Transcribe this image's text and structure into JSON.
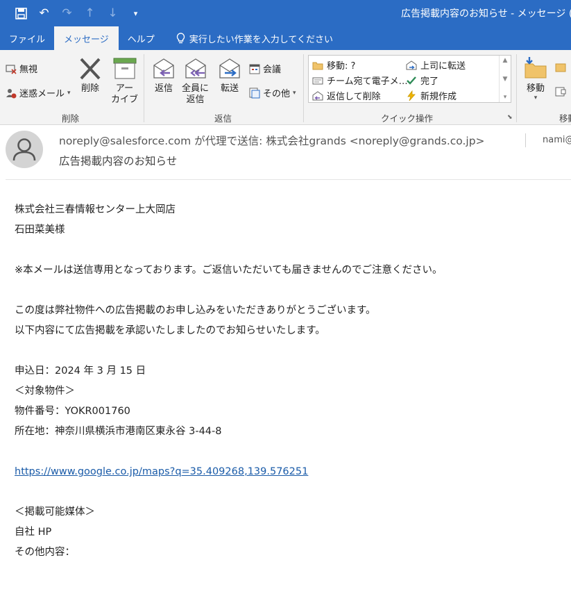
{
  "titlebar": {
    "title": "広告掲載内容のお知らせ  -  メッセージ (テキ"
  },
  "tabs": [
    {
      "label": "ファイル"
    },
    {
      "label": "メッセージ"
    },
    {
      "label": "ヘルプ"
    },
    {
      "label": "実行したい作業を入力してください"
    }
  ],
  "ribbon": {
    "delete_group": {
      "ignore": "無視",
      "junk": "迷惑メール",
      "delete": "削除",
      "archive_1": "アー",
      "archive_2": "カイブ",
      "label": "削除"
    },
    "reply_group": {
      "reply": "返信",
      "reply_all_1": "全員に",
      "reply_all_2": "返信",
      "forward": "転送",
      "meeting": "会議",
      "more": "その他",
      "label": "返信"
    },
    "quick_steps": {
      "items": [
        "移動: ?",
        "チーム宛て電子メ…",
        "返信して削除",
        "上司に転送",
        "完了",
        "新規作成"
      ],
      "label": "クイック操作"
    },
    "move_group": {
      "move": "移動",
      "label": "移動"
    }
  },
  "header": {
    "from": "noreply@salesforce.com が代理で送信: 株式会社grands <noreply@grands.co.jp>",
    "subject": "広告掲載内容のお知らせ",
    "to": "nami@"
  },
  "body": {
    "lines": [
      "株式会社三春情報センター上大岡店",
      "石田菜美様",
      "",
      "※本メールは送信専用となっております。ご返信いただいても届きませんのでご注意ください。",
      "",
      "この度は弊社物件への広告掲載のお申し込みをいただきありがとうございます。",
      "以下内容にて広告掲載を承認いたしましたのでお知らせいたします。",
      "",
      "申込日：2024 年 3 月 15 日",
      "＜対象物件＞",
      "物件番号：YOKR001760",
      "所在地：神奈川県横浜市港南区東永谷 3-44-8",
      "",
      "https://www.google.co.jp/maps?q=35.409268,139.576251",
      "",
      "＜掲載可能媒体＞",
      "自社 HP",
      "その他内容："
    ]
  }
}
